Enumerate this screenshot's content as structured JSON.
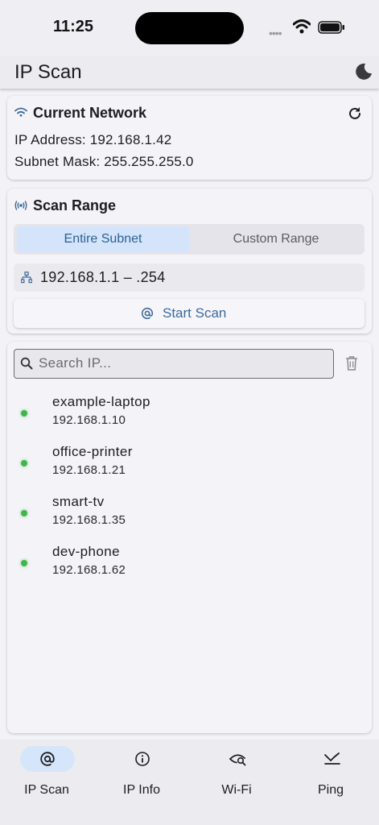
{
  "status_bar": {
    "time": "11:25",
    "dots": "••••"
  },
  "app_bar": {
    "title": "IP Scan"
  },
  "current_network": {
    "title": "Current Network",
    "ip_line": "IP Address: 192.168.1.42",
    "mask_line": "Subnet Mask: 255.255.255.0"
  },
  "scan_range": {
    "title": "Scan Range",
    "segments": [
      "Entire Subnet",
      "Custom Range"
    ],
    "selected_segment": "Entire Subnet",
    "range_text": "192.168.1.1 – .254",
    "start_label": "Start Scan"
  },
  "results": {
    "search_placeholder": "Search IP...",
    "devices": [
      {
        "name": "example-laptop",
        "ip": "192.168.1.10",
        "status": "online"
      },
      {
        "name": "office-printer",
        "ip": "192.168.1.21",
        "status": "online"
      },
      {
        "name": "smart-tv",
        "ip": "192.168.1.35",
        "status": "online"
      },
      {
        "name": "dev-phone",
        "ip": "192.168.1.62",
        "status": "online"
      }
    ]
  },
  "tabs": [
    {
      "label": "IP Scan",
      "icon": "at-icon",
      "active": true
    },
    {
      "label": "IP Info",
      "icon": "info-icon",
      "active": false
    },
    {
      "label": "Wi-Fi",
      "icon": "eye-search-icon",
      "active": false
    },
    {
      "label": "Ping",
      "icon": "ping-icon",
      "active": false
    }
  ],
  "colors": {
    "accent": "#3c6a9a",
    "online": "#3fb649",
    "selected_bg": "#d4e5fb"
  }
}
